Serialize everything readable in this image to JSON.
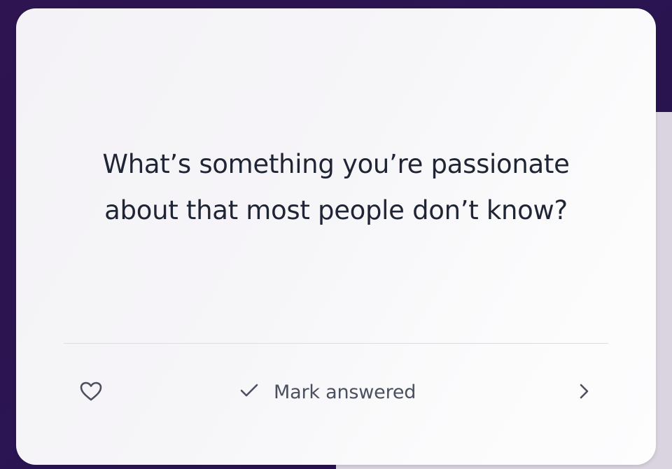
{
  "card": {
    "question": "What’s something you’re passionate about that most people don’t know?"
  },
  "footer": {
    "like_icon": "heart-icon",
    "mark_icon": "check-icon",
    "mark_label": "Mark answered",
    "next_icon": "chevron-right-icon"
  },
  "colors": {
    "background": "#2e1450",
    "card": "#f6f5f8",
    "text": "#1f2535",
    "muted_text": "#4a5060"
  }
}
